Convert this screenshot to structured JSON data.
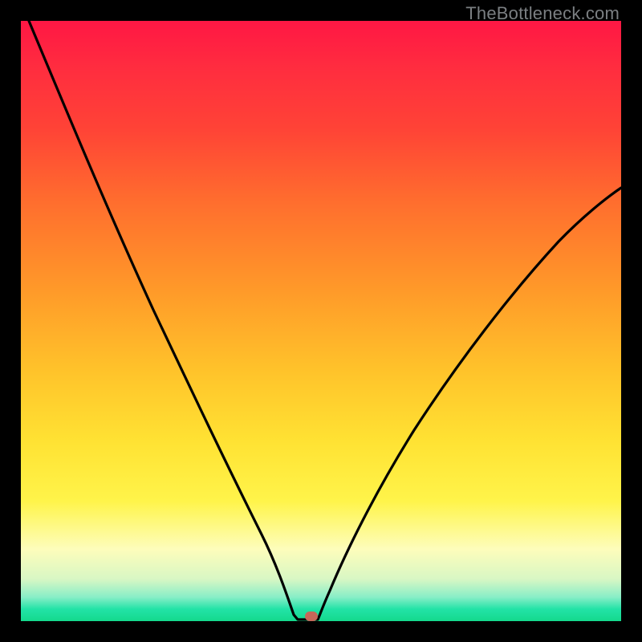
{
  "watermark": "TheBottleneck.com",
  "colors": {
    "frame": "#000000",
    "curve_stroke": "#000000",
    "marker": "#c86658",
    "gradient_top": "#ff1744",
    "gradient_bottom": "#14d98c"
  },
  "chart_data": {
    "type": "line",
    "title": "",
    "xlabel": "",
    "ylabel": "",
    "xlim": [
      0,
      100
    ],
    "ylim": [
      0,
      100
    ],
    "grid": false,
    "annotations": {
      "marker": {
        "x": 48,
        "y": 0,
        "shape": "rounded-rect",
        "color": "#c86658"
      }
    },
    "series": [
      {
        "name": "bottleneck-curve",
        "x": [
          0,
          5,
          10,
          15,
          20,
          25,
          30,
          35,
          40,
          42,
          44,
          45,
          46,
          47,
          48,
          50,
          52,
          55,
          60,
          65,
          70,
          75,
          80,
          85,
          90,
          95,
          100
        ],
        "y": [
          100,
          94,
          87,
          79,
          70,
          60,
          50,
          39,
          22,
          15,
          8,
          3,
          0.5,
          0,
          0,
          0.5,
          3,
          9,
          20,
          30,
          39,
          47,
          54,
          60,
          65,
          69,
          72
        ]
      }
    ]
  }
}
